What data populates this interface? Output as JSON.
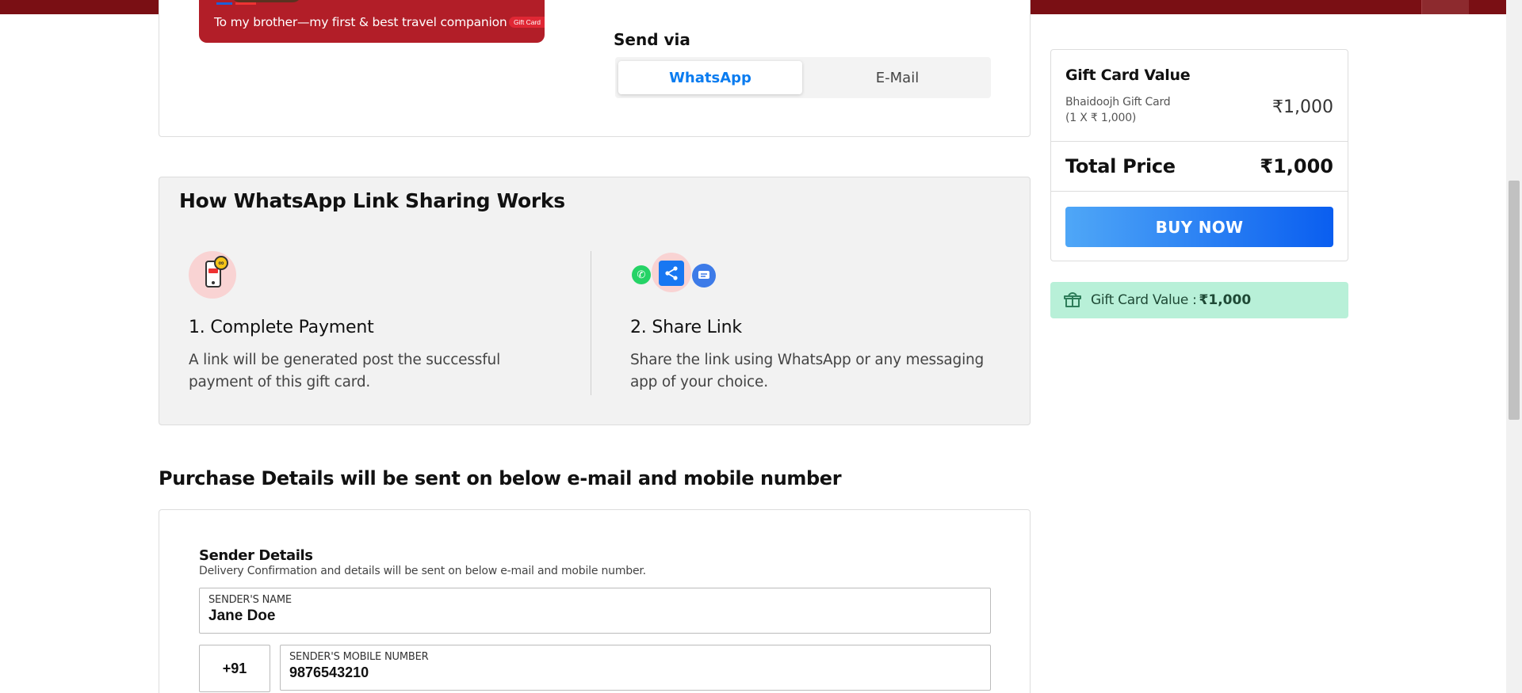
{
  "gift_card_preview": {
    "message": "To my brother—my first & best travel companion",
    "tag": "Gift Card"
  },
  "send_via": {
    "label": "Send via",
    "options": [
      "WhatsApp",
      "E-Mail"
    ],
    "selected": "WhatsApp"
  },
  "how_it_works": {
    "title": "How WhatsApp Link Sharing Works",
    "steps": [
      {
        "title": "1. Complete Payment",
        "description": "A link will be generated post the successful payment of this gift card."
      },
      {
        "title": "2. Share Link",
        "description": "Share the link using WhatsApp or any messaging app of your choice."
      }
    ]
  },
  "purchase_details": {
    "heading": "Purchase Details will be sent on below e-mail and mobile number"
  },
  "sender": {
    "title": "Sender Details",
    "subtitle": "Delivery Confirmation and details will be sent on below e-mail and mobile number.",
    "name_label": "SENDER'S NAME",
    "name_value": "Jane Doe",
    "country_code": "+91",
    "mobile_label": "SENDER'S MOBILE NUMBER",
    "mobile_value": "9876543210"
  },
  "summary": {
    "title": "Gift Card Value",
    "item_name": "Bhaidoojh Gift Card",
    "item_qty": "(1 X ₹ 1,000)",
    "item_price": "₹1,000",
    "total_label": "Total Price",
    "total_value": "₹1,000",
    "buy_label": "BUY NOW"
  },
  "gift_value_bar": {
    "label": "Gift Card Value :",
    "value": "₹1,000"
  },
  "colors": {
    "accent_blue": "#0a7cf0",
    "buy_gradient_start": "#4fa7f7",
    "buy_gradient_end": "#0a5ef0",
    "banner_red": "#7a0f14",
    "gift_value_bg": "#b8f0d8"
  }
}
